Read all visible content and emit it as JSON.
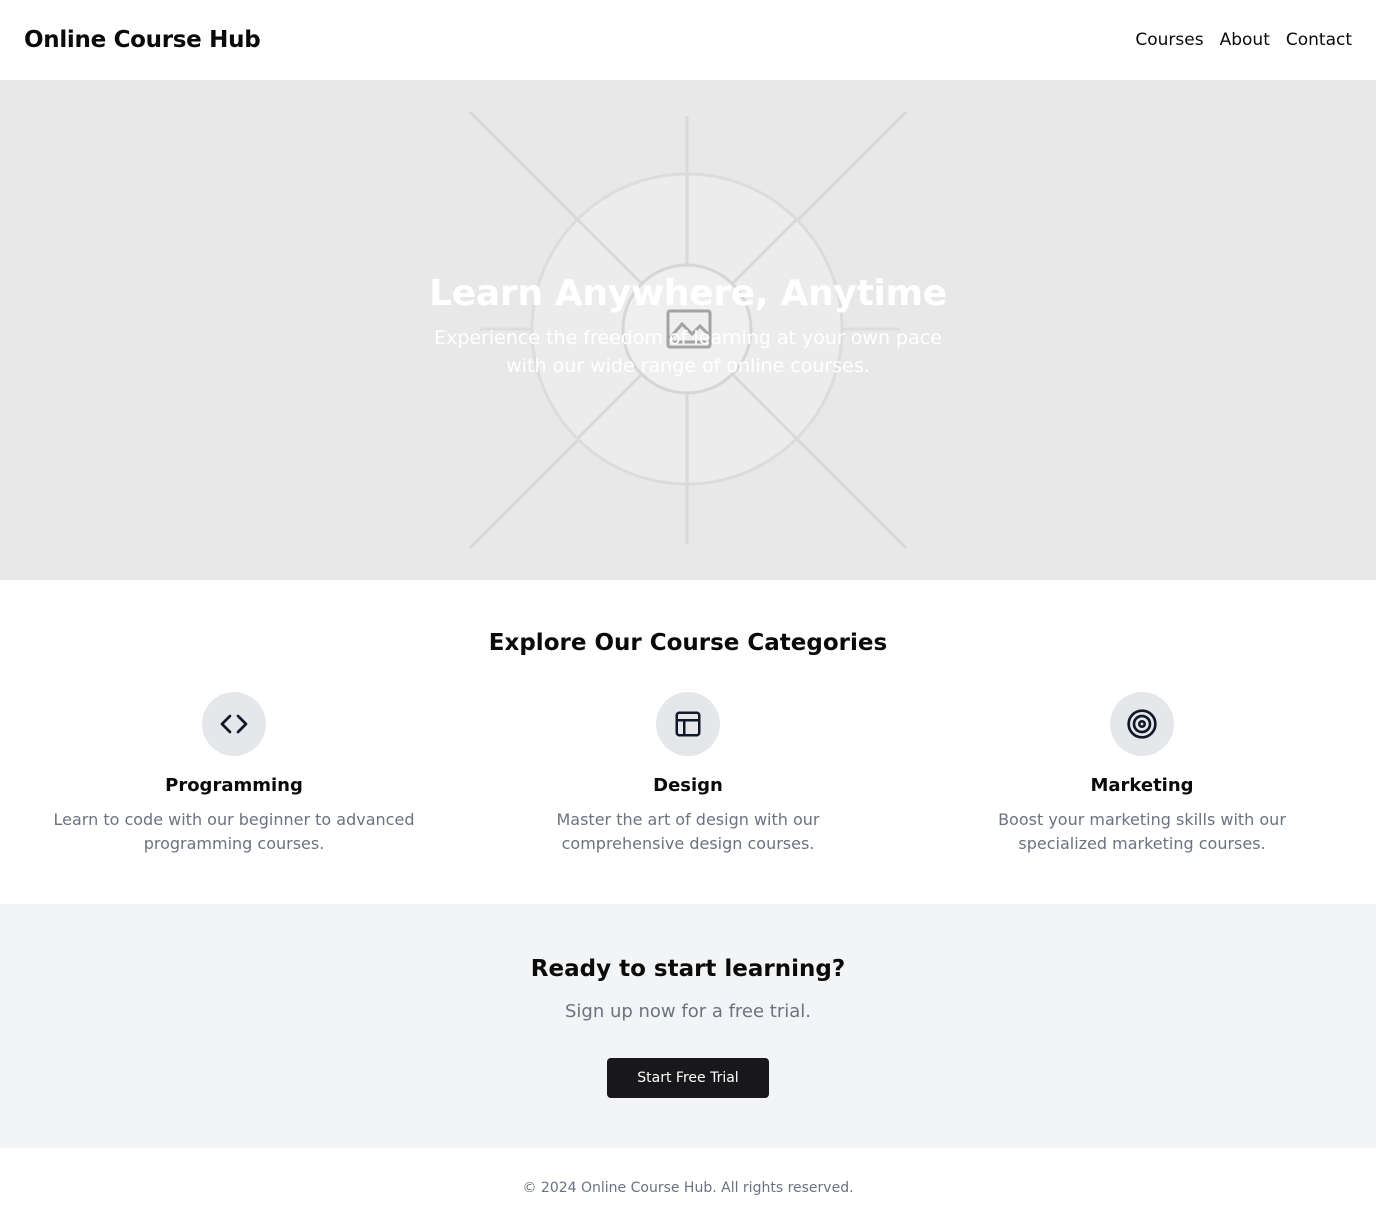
{
  "header": {
    "brand": "Online Course Hub",
    "nav": [
      {
        "label": "Courses"
      },
      {
        "label": "About"
      },
      {
        "label": "Contact"
      }
    ]
  },
  "hero": {
    "title": "Learn Anywhere, Anytime",
    "subtitle": "Experience the freedom of learning at your own pace with our wide range of online courses.",
    "image_icon": "image-placeholder-icon"
  },
  "categories": {
    "title": "Explore Our Course Categories",
    "items": [
      {
        "icon": "code-icon",
        "title": "Programming",
        "description": "Learn to code with our beginner to advanced programming courses."
      },
      {
        "icon": "layout-icon",
        "title": "Design",
        "description": "Master the art of design with our comprehensive design courses."
      },
      {
        "icon": "target-icon",
        "title": "Marketing",
        "description": "Boost your marketing skills with our specialized marketing courses."
      }
    ]
  },
  "cta": {
    "title": "Ready to start learning?",
    "subtitle": "Sign up now for a free trial.",
    "button_label": "Start Free Trial"
  },
  "footer": {
    "copyright": "© 2024 Online Course Hub. All rights reserved."
  },
  "colors": {
    "hero_bg": "#e8e8e8",
    "section_alt_bg": "#f3f4f6",
    "icon_circle_bg": "#e5e7eb",
    "button_bg": "#18181b",
    "muted_text": "#6b7280"
  }
}
